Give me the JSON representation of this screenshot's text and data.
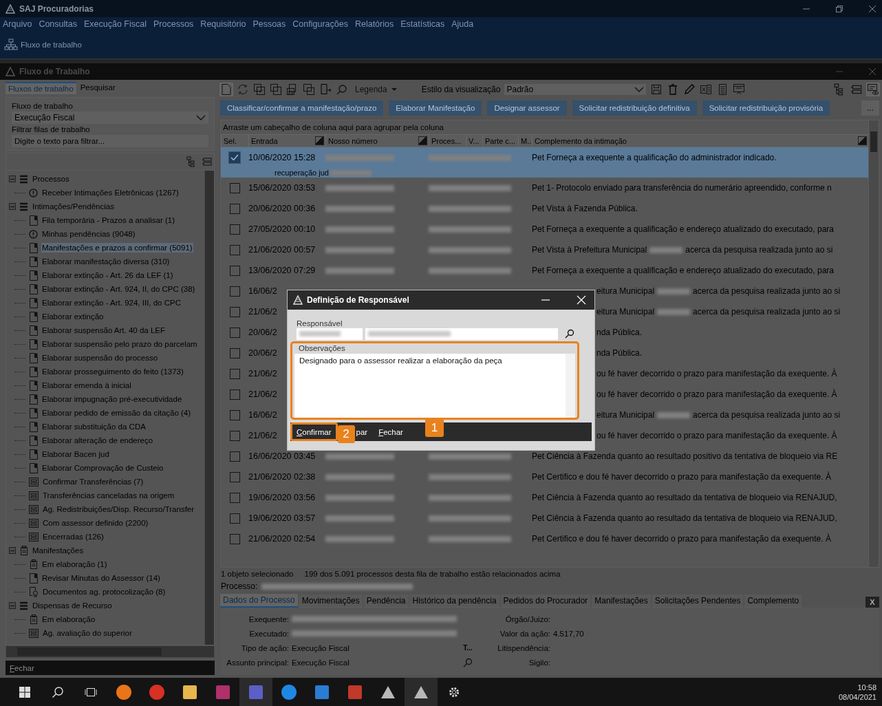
{
  "app": {
    "title": "SAJ Procuradorias",
    "menu": [
      "Arquivo",
      "Consultas",
      "Execução Fiscal",
      "Processos",
      "Requisitório",
      "Pessoas",
      "Configurações",
      "Relatórios",
      "Estatísticas",
      "Ajuda"
    ],
    "toolbar_button": "Fluxo de trabalho"
  },
  "window": {
    "title": "Fluxo de Trabalho"
  },
  "left_panel": {
    "tabs": [
      {
        "label": "Fluxos de trabalho",
        "selected": true
      },
      {
        "label": "Pesquisar",
        "selected": false
      }
    ],
    "workflow_label": "Fluxo de trabalho",
    "workflow_value": "Execução Fiscal",
    "filter_label": "Filtrar filas de trabalho",
    "filter_placeholder": "Digite o texto para filtrar...",
    "tree": [
      {
        "label": "Processos",
        "kind": "list",
        "expanded": true,
        "selected": false,
        "children": [
          {
            "label": "Receber Intimações Eletrônicas (1267)",
            "kind": "alert",
            "selected": false
          }
        ]
      },
      {
        "label": "Intimações/Pendências",
        "kind": "list",
        "expanded": true,
        "selected": false,
        "children": [
          {
            "label": "Fila temporária - Prazos a analisar (1)",
            "kind": "doc",
            "selected": false
          },
          {
            "label": "Minhas pendências (9048)",
            "kind": "alert",
            "selected": false
          },
          {
            "label": "Manifestações e prazos a confirmar (5091)",
            "kind": "doc",
            "selected": true
          },
          {
            "label": "Elaborar manifestação diversa (310)",
            "kind": "doc",
            "selected": false
          },
          {
            "label": "Elaborar extinção - Art. 26 da LEF (1)",
            "kind": "doc",
            "selected": false
          },
          {
            "label": "Elaborar extinção - Art. 924, II, do CPC (38)",
            "kind": "doc",
            "selected": false
          },
          {
            "label": "Elaborar extinção - Art. 924, III, do CPC",
            "kind": "doc",
            "selected": false
          },
          {
            "label": "Elaborar extinção",
            "kind": "doc",
            "selected": false
          },
          {
            "label": "Elaborar suspensão Art. 40 da LEF",
            "kind": "doc",
            "selected": false
          },
          {
            "label": "Elaborar suspensão pelo prazo do parcelam",
            "kind": "doc",
            "selected": false
          },
          {
            "label": "Elaborar suspensão do processo",
            "kind": "doc",
            "selected": false
          },
          {
            "label": "Elaborar prosseguimento do feito (1373)",
            "kind": "doc",
            "selected": false
          },
          {
            "label": "Elaborar emenda à inicial",
            "kind": "doc",
            "selected": false
          },
          {
            "label": "Elaborar impugnação pré-executividade",
            "kind": "doc",
            "selected": false
          },
          {
            "label": "Elaborar pedido de emissão da citação (4)",
            "kind": "doc",
            "selected": false
          },
          {
            "label": "Elaborar substituição da CDA",
            "kind": "doc",
            "selected": false
          },
          {
            "label": "Elaborar alteração de endereço",
            "kind": "doc",
            "selected": false
          },
          {
            "label": "Elaborar Bacen jud",
            "kind": "doc",
            "selected": false
          },
          {
            "label": "Elaborar Comprovação de Custeio",
            "kind": "doc",
            "selected": false
          },
          {
            "label": "Confirmar Transferências (7)",
            "kind": "tray",
            "selected": false
          },
          {
            "label": "Transferências canceladas na origem",
            "kind": "tray",
            "selected": false
          },
          {
            "label": "Ag. Redistribuições/Disp. Recurso/Transfer",
            "kind": "tray",
            "selected": false
          },
          {
            "label": "Com assessor definido (2200)",
            "kind": "tray",
            "selected": false
          },
          {
            "label": "Encerradas (126)",
            "kind": "tray",
            "selected": false
          }
        ]
      },
      {
        "label": "Manifestações",
        "kind": "clipboard",
        "expanded": true,
        "selected": false,
        "children": [
          {
            "label": "Em elaboração (1)",
            "kind": "clipboard",
            "selected": false
          },
          {
            "label": "Revisar Minutas do Assessor (14)",
            "kind": "doc",
            "selected": false
          },
          {
            "label": "Documentos ag. protocolização (8)",
            "kind": "cert",
            "selected": false
          }
        ]
      },
      {
        "label": "Dispensas de Recurso",
        "kind": "list",
        "expanded": true,
        "selected": false,
        "children": [
          {
            "label": "Em elaboração",
            "kind": "clipboard",
            "selected": false
          },
          {
            "label": "Ag. avaliação do superior",
            "kind": "tray",
            "selected": false
          }
        ]
      }
    ],
    "close_button": "Fechar"
  },
  "main": {
    "legend": "Legenda",
    "view_style_label": "Estilo da visualização",
    "view_style_value": "Padrão",
    "actions": [
      "Classificar/confirmar a manifestação/prazo",
      "Elaborar Manifestação",
      "Designar assessor",
      "Solicitar redistribuição definitiva",
      "Solicitar redistribuição provisória"
    ],
    "more": "...",
    "group_hint": "Arraste um cabeçalho de coluna aqui para agrupar pela coluna",
    "columns": [
      "Sel.",
      "Entrada",
      "Nosso número",
      "Proces...",
      "V...",
      "Parte c...",
      "M..",
      "Complemento da intimação"
    ],
    "rows": [
      {
        "kind": "full",
        "checked": true,
        "selected": true,
        "date": "10/06/2020 15:28",
        "complement": [
          "Pet Forneça a exequente a qualificação do administrador indicado."
        ],
        "note": "recuperação jud"
      },
      {
        "kind": "full",
        "checked": false,
        "selected": false,
        "date": "15/06/2020 03:53",
        "complement": [
          "Pet 1- Protocolo enviado para transferência do numerário apreendido, conforme n"
        ]
      },
      {
        "kind": "full",
        "checked": false,
        "selected": false,
        "date": "20/06/2020 00:36",
        "complement": [
          "Pet Vista à Fazenda Pública."
        ]
      },
      {
        "kind": "full",
        "checked": false,
        "selected": false,
        "date": "27/05/2020 00:10",
        "complement": [
          "Pet Forneça a exequente a qualificação e endereço atualizado do executado, para"
        ]
      },
      {
        "kind": "full",
        "checked": false,
        "selected": false,
        "date": "21/06/2020 00:57",
        "complement": [
          "Pet Vista à Prefeitura Municipal",
          "acerca da pesquisa realizada junto ao si"
        ]
      },
      {
        "kind": "full",
        "checked": false,
        "selected": false,
        "date": "13/06/2020 07:29",
        "complement": [
          "Pet Forneça a exequente a qualificação e endereço atualizado do executado, para"
        ]
      },
      {
        "kind": "covered",
        "checked": false,
        "selected": false,
        "date": "16/06/2",
        "complement": [
          "eitura Municipal",
          "acerca da pesquisa realizada junto ao si"
        ]
      },
      {
        "kind": "covered",
        "checked": false,
        "selected": false,
        "date": "21/06/2",
        "complement": [
          "eitura Municipal",
          "acerca da pesquisa realizada junto ao si"
        ]
      },
      {
        "kind": "covered",
        "checked": false,
        "selected": false,
        "date": "20/06/2",
        "complement": [
          "nda Pública."
        ]
      },
      {
        "kind": "covered",
        "checked": false,
        "selected": false,
        "date": "20/06/2",
        "complement": [
          "nda Pública."
        ]
      },
      {
        "kind": "covered",
        "checked": false,
        "selected": false,
        "date": "21/06/2",
        "complement": [
          "ou fé haver decorrido o prazo para manifestação da exequente. À"
        ]
      },
      {
        "kind": "covered",
        "checked": false,
        "selected": false,
        "date": "21/06/2",
        "complement": [
          "ou fé haver decorrido o prazo para manifestação da exequente. À"
        ]
      },
      {
        "kind": "covered",
        "checked": false,
        "selected": false,
        "date": "16/06/2",
        "complement": [
          "eitura Municipal",
          "acerca da pesquisa realizada junto ao si"
        ]
      },
      {
        "kind": "covered",
        "checked": false,
        "selected": false,
        "date": "21/06/2",
        "complement": [
          "ou fé haver decorrido o prazo para manifestação da exequente. À"
        ]
      },
      {
        "kind": "full",
        "checked": false,
        "selected": false,
        "date": "16/06/2020 03:45",
        "complement": [
          "Pet Ciência à Fazenda quanto ao resultado positivo da tentativa de bloqueio via RE"
        ]
      },
      {
        "kind": "full",
        "checked": false,
        "selected": false,
        "date": "21/06/2020 02:38",
        "complement": [
          "Pet Certifico e dou fé haver decorrido o prazo para manifestação da exequente. À"
        ]
      },
      {
        "kind": "full",
        "checked": false,
        "selected": false,
        "date": "19/06/2020 03:56",
        "complement": [
          "Pet Ciência à Fazenda quanto ao resultado da tentativa de bloqueio via RENAJUD,"
        ]
      },
      {
        "kind": "full",
        "checked": false,
        "selected": false,
        "date": "19/06/2020 03:57",
        "complement": [
          "Pet Ciência à Fazenda quanto ao resultado da tentativa de bloqueio via RENAJUD,"
        ]
      },
      {
        "kind": "full",
        "checked": false,
        "selected": false,
        "date": "21/06/2020 02:54",
        "complement": [
          "Pet Certifico e dou fé haver decorrido o prazo para manifestação da exequente. À"
        ]
      }
    ],
    "status": [
      "1 objeto selecionado",
      "199 dos 5.091 processos desta fila de trabalho estão relacionados acima"
    ],
    "process_label": "Processo:",
    "detail_tabs": [
      {
        "label": "Dados do Processo",
        "selected": true
      },
      {
        "label": "Movimentações",
        "selected": false
      },
      {
        "label": "Pendência",
        "selected": false
      },
      {
        "label": "Histórico da pendência",
        "selected": false
      },
      {
        "label": "Pedidos do Procurador",
        "selected": false
      },
      {
        "label": "Manifestações",
        "selected": false
      },
      {
        "label": "Solicitações Pendentes",
        "selected": false
      },
      {
        "label": "Complemento",
        "selected": false
      }
    ],
    "detail_close": "X",
    "details_left": [
      {
        "label": "Exequente:",
        "redacted": true,
        "search": false
      },
      {
        "label": "Executado:",
        "redacted": true,
        "search": false
      },
      {
        "label": "Tipo de ação:",
        "value": "Execução Fiscal",
        "side": "T...",
        "redacted": false,
        "search": false
      },
      {
        "label": "Assunto principal:",
        "value": "Execução Fiscal",
        "redacted": false,
        "search": true
      }
    ],
    "details_right": [
      {
        "label": "Órgão/Juizo:"
      },
      {
        "label": "Valor da ação:",
        "value": "4.517,70"
      },
      {
        "label": "Litispendência:"
      },
      {
        "label": "Sigilo:"
      }
    ]
  },
  "dialog": {
    "title": "Definição de Responsável",
    "responsible_label": "Responsável",
    "notes_label": "Observações",
    "notes_value": "Designado para o assessor realizar a elaboração da peça",
    "buttons": [
      "Confirmar",
      "par",
      "Fechar"
    ],
    "callouts": [
      "1",
      "2"
    ]
  },
  "taskbar": {
    "time": "10:58",
    "date": "08/04/2021"
  }
}
